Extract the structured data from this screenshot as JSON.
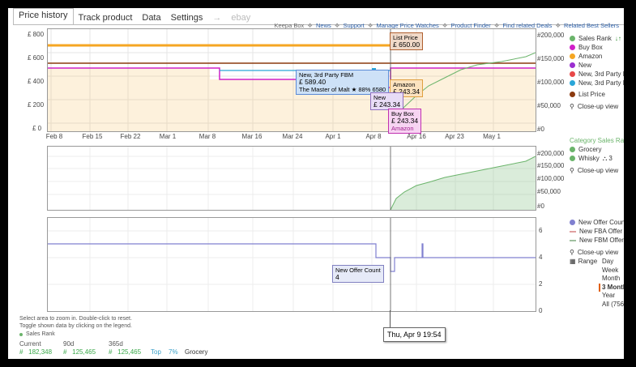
{
  "tabs": [
    {
      "label": "Price history"
    },
    {
      "label": "Track product"
    },
    {
      "label": "Data"
    },
    {
      "label": "Settings"
    },
    {
      "label": "→"
    },
    {
      "label": "ebay"
    }
  ],
  "toplinks": [
    "Keepa Box",
    "News",
    "Support",
    "Manage Price Watches",
    "Product Finder",
    "Find related Deals",
    "Related Best Sellers"
  ],
  "colors": {
    "amazon": "#f5a623",
    "list_price": "#8b3a0f",
    "buy_box": "#d020c8",
    "new": "#9a2ed0",
    "third_fbm": "#2aa6d8",
    "sales_rank": "#6bb46b",
    "offer_count": "#8080d0"
  },
  "price_chart": {
    "y_ticks": [
      "£ 800",
      "£ 600",
      "£ 400",
      "£ 200",
      "£ 0"
    ],
    "y2_ticks": [
      "#200,000",
      "#150,000",
      "#100,000",
      "#50,000",
      "#0"
    ],
    "x_ticks": [
      "Feb 8",
      "Feb 15",
      "Feb 22",
      "Mar 1",
      "Mar 8",
      "Mar 16",
      "Mar 24",
      "Apr 1",
      "Apr 8",
      "Apr 16",
      "Apr 23",
      "May 1"
    ]
  },
  "rank_chart": {
    "y2_ticks": [
      "#200,000",
      "#150,000",
      "#100,000",
      "#50,000",
      "#0"
    ]
  },
  "offer_chart": {
    "y_ticks": [
      "6",
      "4",
      "2",
      "0"
    ]
  },
  "tooltips": {
    "list_price": {
      "title": "List Price",
      "value": "£ 650.00"
    },
    "third_fbm": {
      "title": "New, 3rd Party FBM",
      "value": "£ 589.40",
      "seller": "The Master of Malt",
      "rating": "★ 88%",
      "count": "6580"
    },
    "amazon": {
      "title": "Amazon",
      "value": "£ 243.34"
    },
    "new": {
      "title": "New",
      "value": "£ 243.34"
    },
    "buy_box": {
      "title": "Buy Box",
      "value": "£ 243.34",
      "seller": "Amazon"
    },
    "offer_count": {
      "title": "New Offer Count",
      "value": "4"
    }
  },
  "legend_price": [
    "Sales Rank",
    "Buy Box",
    "Amazon",
    "New",
    "New, 3rd Party FB",
    "New, 3rd Party FB",
    "List Price"
  ],
  "closeup": "Close-up view",
  "legend_rank": {
    "header": "Category Sales Ranks",
    "items": [
      "Grocery",
      "Whisky",
      "3"
    ]
  },
  "legend_offer": [
    "New Offer Count",
    "New FBA Offer Co",
    "New FBM Offer Co"
  ],
  "range": {
    "label": "Range",
    "options": [
      "Day",
      "Week",
      "Month",
      "3 Month",
      "Year",
      "All (756 d"
    ]
  },
  "crosshair_date": "Thu, Apr 9 19:54",
  "footer": {
    "hint1": "Select area to zoom in. Double-click to reset.",
    "hint2": "Toggle shown data by clicking on the legend.",
    "rank_label": "Sales Rank",
    "cols": [
      "Current",
      "90d",
      "365d"
    ],
    "values": [
      "182,348",
      "125,465",
      "125,465"
    ],
    "top": "Top",
    "top_pct": "7%",
    "category": "Grocery"
  },
  "chart_data": {
    "type": "line",
    "title": "",
    "x_range": [
      "Feb 8",
      "May 7"
    ],
    "series": [
      {
        "name": "Amazon",
        "points": [
          [
            "Feb 8",
            800
          ],
          [
            "Apr 9",
            800
          ]
        ]
      },
      {
        "name": "List Price",
        "points": [
          [
            "Feb 8",
            650
          ],
          [
            "May 7",
            650
          ]
        ]
      },
      {
        "name": "Buy Box",
        "points": [
          [
            "Feb 8",
            600
          ],
          [
            "Mar 8",
            600
          ],
          [
            "Mar 10",
            500
          ],
          [
            "Mar 28",
            500
          ],
          [
            "Mar 29",
            430
          ],
          [
            "Apr 8",
            430
          ],
          [
            "Apr 9",
            600
          ],
          [
            "May 7",
            600
          ]
        ]
      },
      {
        "name": "New, 3rd Party FBM",
        "points": [
          [
            "Mar 10",
            589.4
          ],
          [
            "Apr 9",
            589.4
          ]
        ]
      },
      {
        "name": "Sales Rank",
        "points": [
          [
            "Apr 9",
            10000
          ],
          [
            "Apr 16",
            90000
          ],
          [
            "Apr 23",
            120000
          ],
          [
            "May 1",
            150000
          ],
          [
            "May 7",
            190000
          ]
        ]
      },
      {
        "name": "New Offer Count",
        "points": [
          [
            "Feb 8",
            5
          ],
          [
            "Apr 5",
            5
          ],
          [
            "Apr 5",
            4
          ],
          [
            "Apr 9",
            4
          ],
          [
            "Apr 9",
            3
          ],
          [
            "Apr 10",
            4
          ],
          [
            "May 7",
            4
          ]
        ]
      }
    ]
  }
}
